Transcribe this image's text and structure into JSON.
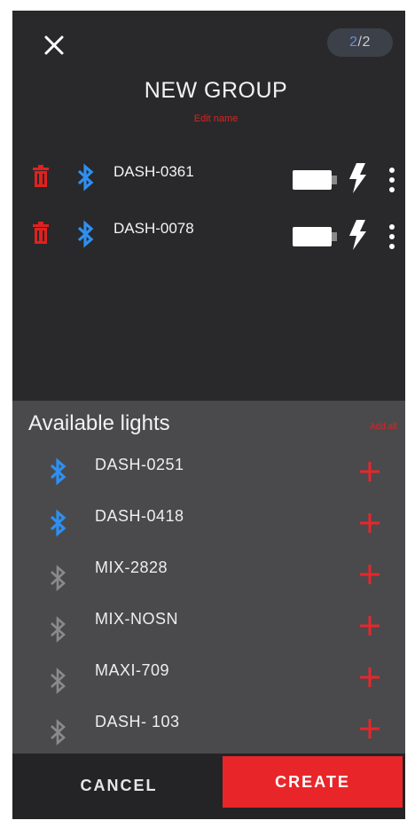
{
  "header": {
    "page_current": "2",
    "page_separator": "/",
    "page_total": "2"
  },
  "group": {
    "title": "NEW GROUP",
    "edit_name_label": "Edit name"
  },
  "group_lights": [
    {
      "name": "DASH-0361",
      "bluetooth": "connected"
    },
    {
      "name": "DASH-0078",
      "bluetooth": "connected"
    }
  ],
  "available": {
    "title": "Available lights",
    "add_all_label": "Add all",
    "items": [
      {
        "name": "DASH-0251",
        "bluetooth": "connected"
      },
      {
        "name": "DASH-0418",
        "bluetooth": "connected"
      },
      {
        "name": "MIX-2828",
        "bluetooth": "disabled"
      },
      {
        "name": "MIX-NOSN",
        "bluetooth": "disabled"
      },
      {
        "name": "MAXI-709",
        "bluetooth": "disabled"
      },
      {
        "name": "DASH- 103",
        "bluetooth": "disabled"
      }
    ]
  },
  "footer": {
    "cancel_label": "CANCEL",
    "create_label": "CREATE"
  },
  "colors": {
    "accent_red": "#e8262a",
    "bluetooth_blue": "#2f8ff0",
    "bluetooth_gray": "#8a8a8a",
    "background": "#2a2a2c",
    "panel": "#4a4a4c"
  },
  "icons": [
    "close-icon",
    "trash-icon",
    "bluetooth-icon",
    "battery-icon",
    "lightning-bolt-icon",
    "more-vertical-icon",
    "plus-icon"
  ]
}
